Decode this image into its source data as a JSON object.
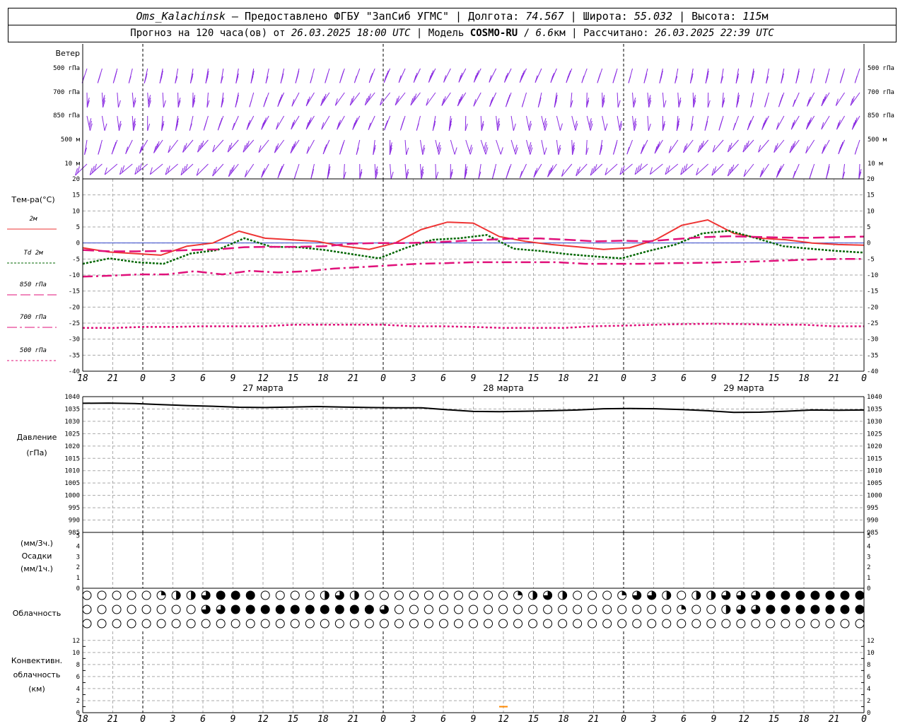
{
  "header": {
    "station": "Oms_Kalachinsk",
    "dash": "—",
    "provider": "Предоставлено ФГБУ \"ЗапСиб УГМС\"",
    "lon_label": "Долгота:",
    "lon": "74.567",
    "lat_label": "Широта:",
    "lat": "55.032",
    "alt_label": "Высота:",
    "alt": "115",
    "alt_unit": "м",
    "sep": "|"
  },
  "subheader": {
    "forecast_label": "Прогноз на 120 часа(ов) от",
    "start": "26.03.2025 18:00 UTC",
    "model_label": "Модель",
    "model": "COSMO-RU",
    "res": "6.6",
    "res_unit": "км",
    "calc_label": "Рассчитано:",
    "calc": "26.03.2025 22:39 UTC"
  },
  "wind_panel": {
    "title": "Ветер",
    "levels": [
      "500 гПа",
      "700 гПа",
      "850 гПа",
      "500 м",
      "10  м"
    ],
    "barb_color": "#8a2be2"
  },
  "temp_panel": {
    "title": "Тем-ра(°C)",
    "yticks": [
      "20",
      "15",
      "10",
      "5",
      "0",
      "-5",
      "-10",
      "-15",
      "-20",
      "-25",
      "-30",
      "-35",
      "-40"
    ],
    "legend": [
      {
        "name": "2м",
        "color": "#ee3333"
      },
      {
        "name": "Td  2м",
        "color": "#006600"
      },
      {
        "name": "850 гПа",
        "color": "#e0107a"
      },
      {
        "name": "700 гПа",
        "color": "#e0107a"
      },
      {
        "name": "500 гПа",
        "color": "#e0107a"
      }
    ]
  },
  "pressure_panel": {
    "title": "Давление",
    "unit": "(гПа)",
    "yticks": [
      "1040",
      "1035",
      "1030",
      "1025",
      "1020",
      "1015",
      "1010",
      "1005",
      "1000",
      "995",
      "990",
      "985"
    ]
  },
  "precip_panel": {
    "unit3": "(мм/3ч.)",
    "title": "Осадки",
    "unit1": "(мм/1ч.)",
    "yticks": [
      "5",
      "4",
      "3",
      "2",
      "1",
      "0"
    ]
  },
  "cloud_panel": {
    "title": "Облачность"
  },
  "conv_panel": {
    "line1": "Конвективн.",
    "line2": "облачность",
    "line3": "(км)",
    "yticks": [
      "12",
      "10",
      "8",
      "6",
      "4",
      "2",
      "0"
    ]
  },
  "x_ticks": [
    "18",
    "21",
    "0",
    "3",
    "6",
    "9",
    "12",
    "15",
    "18",
    "21",
    "0",
    "3",
    "6",
    "9",
    "12",
    "15",
    "18",
    "21",
    "0",
    "3",
    "6",
    "9",
    "12",
    "15",
    "18",
    "21",
    "0"
  ],
  "x_bottom_ticks": [
    "18",
    "21",
    "0",
    "3",
    "6",
    "9",
    "12",
    "15",
    "18",
    "21",
    "0",
    "3",
    "6",
    "9",
    "12",
    "15",
    "18",
    "21",
    "0",
    "3",
    "6",
    "9",
    "12",
    "15",
    "18",
    "21",
    "0"
  ],
  "dates": [
    "27 марта",
    "28 марта",
    "29 марта"
  ],
  "chart_data": [
    {
      "type": "line",
      "title": "Тем-ра(°C)",
      "x_hours": [
        0,
        3,
        6,
        9,
        12,
        15,
        18,
        21,
        24,
        27,
        30,
        33,
        36,
        39,
        42,
        45,
        48,
        51,
        54,
        57,
        60,
        63,
        66,
        69,
        72,
        75,
        78
      ],
      "ylim": [
        -40,
        20
      ],
      "series": [
        {
          "name": "2м",
          "values": [
            -1.5,
            -2.8,
            -3.3,
            -3.8,
            -1,
            0,
            3.7,
            1.5,
            1,
            0.5,
            -1,
            -2,
            0,
            4.2,
            6.5,
            6.2,
            2,
            0.5,
            -0.5,
            -1.2,
            -2,
            -1.5,
            1,
            5.5,
            7.2,
            3,
            1.5,
            1,
            0,
            -0.5,
            -0.7
          ]
        },
        {
          "name": "Td  2м",
          "values": [
            -6.5,
            -4.8,
            -6,
            -6.5,
            -3.3,
            -2.2,
            1.5,
            -1.2,
            -1.3,
            -2.2,
            -3.5,
            -4.8,
            -1.5,
            1,
            1.5,
            2.5,
            -1.8,
            -2.5,
            -3.5,
            -4.2,
            -4.8,
            -2.5,
            -0.5,
            3,
            3.8,
            1.5,
            -1,
            -1.8,
            -2.5,
            -3
          ]
        },
        {
          "name": "850 гПа",
          "values": [
            -2.2,
            -2.6,
            -2.6,
            -2.5,
            -2.2,
            -2,
            -1.3,
            -1.2,
            -1.2,
            -1,
            -0.2,
            0,
            0,
            0.2,
            0.6,
            1,
            1.4,
            1.4,
            1,
            0.5,
            0.7,
            0.5,
            1.2,
            1.8,
            2.1,
            1.9,
            1.7,
            1.6,
            1.8,
            2
          ]
        },
        {
          "name": "700 гПа",
          "values": [
            -10.5,
            -10.2,
            -9.8,
            -9.8,
            -8.8,
            -9.8,
            -8.7,
            -9.2,
            -8.8,
            -8,
            -7.5,
            -7,
            -6.5,
            -6.3,
            -6,
            -6,
            -6,
            -6,
            -6.5,
            -6.5,
            -6.5,
            -6.3,
            -6.2,
            -6,
            -5.8,
            -5.5,
            -5.2,
            -5,
            -5
          ]
        },
        {
          "name": "500 гПа",
          "values": [
            -26.5,
            -26.5,
            -26.2,
            -26.2,
            -26,
            -26,
            -26,
            -25.5,
            -25.5,
            -25.5,
            -25.5,
            -26,
            -26,
            -26.2,
            -26.5,
            -26.5,
            -26.5,
            -26,
            -25.8,
            -25.5,
            -25.3,
            -25.2,
            -25.3,
            -25.5,
            -25.5,
            -26,
            -26
          ]
        }
      ]
    },
    {
      "type": "line",
      "title": "Давление",
      "ylim": [
        985,
        1040
      ],
      "series": [
        {
          "name": "Давление",
          "values": [
            1037.3,
            1037.4,
            1037.2,
            1036.8,
            1036.4,
            1036.1,
            1035.7,
            1035.6,
            1035.8,
            1036,
            1035.8,
            1035.6,
            1035.5,
            1035.5,
            1034.7,
            1034,
            1033.9,
            1034.1,
            1034.3,
            1034.6,
            1035.1,
            1035.2,
            1035.1,
            1034.8,
            1034.3,
            1033.6,
            1033.7,
            1034.1,
            1034.6,
            1034.5,
            1034.6
          ]
        }
      ]
    },
    {
      "type": "bar",
      "title": "Осадки",
      "ylim": [
        0,
        5
      ],
      "values": []
    },
    {
      "type": "bar",
      "title": "Конвективн. облачность (км)",
      "ylim": [
        0,
        13
      ],
      "values": [
        {
          "x_hours": 42,
          "value": 1
        }
      ]
    }
  ]
}
